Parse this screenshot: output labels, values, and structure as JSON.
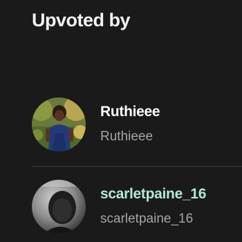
{
  "header": {
    "title": "Upvoted by"
  },
  "voters": [
    {
      "display_name": "Ruthieee",
      "username": "Ruthieee",
      "name_color": "#ffffff"
    },
    {
      "display_name": "scarletpaine_16",
      "username": "scarletpaine_16",
      "name_color": "#b3e8d6"
    }
  ],
  "colors": {
    "background": "#1a1a1a",
    "handle": "#a6a6a6",
    "divider": "#3a3a3a"
  }
}
